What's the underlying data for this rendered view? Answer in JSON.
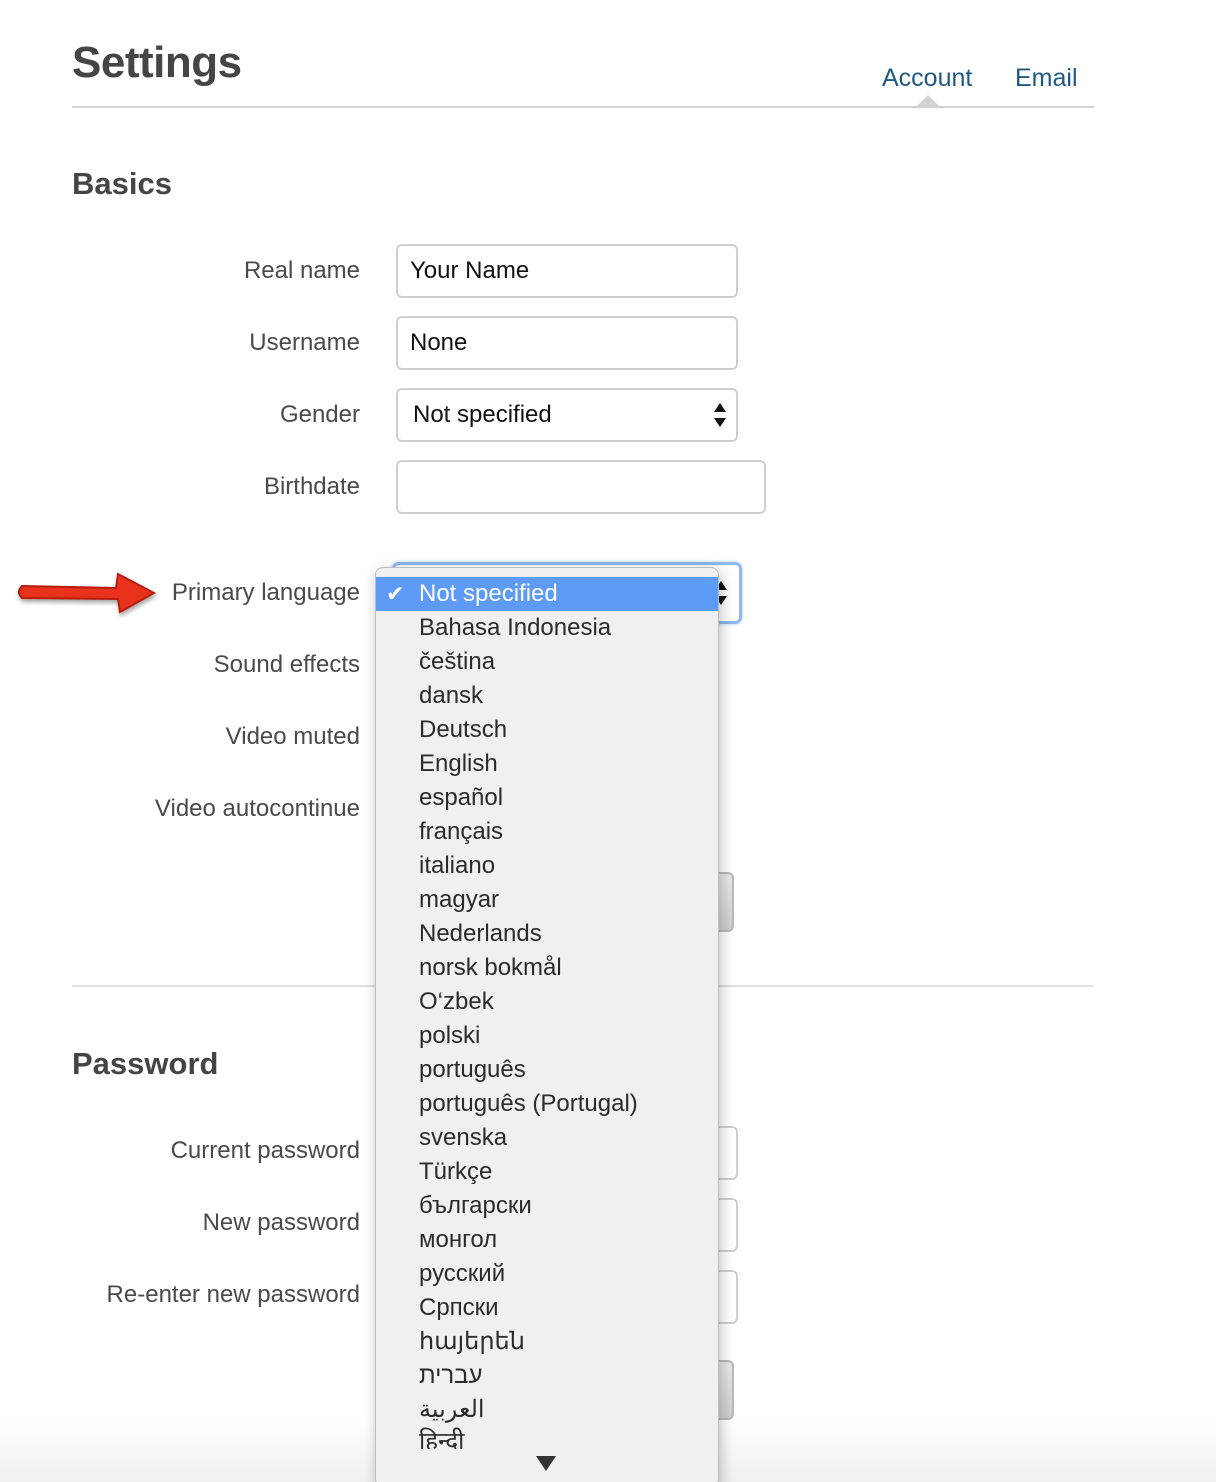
{
  "header": {
    "title": "Settings",
    "tabs": [
      {
        "label": "Account",
        "active": true
      },
      {
        "label": "Email",
        "active": false
      }
    ]
  },
  "basics": {
    "title": "Basics",
    "fields": {
      "real_name": {
        "label": "Real name",
        "value": "Your Name"
      },
      "username": {
        "label": "Username",
        "value": "None"
      },
      "gender": {
        "label": "Gender",
        "value": "Not specified"
      },
      "birthdate": {
        "label": "Birthdate",
        "value": ""
      },
      "primary_language": {
        "label": "Primary language",
        "value": "Not specified"
      },
      "sound_effects": {
        "label": "Sound effects"
      },
      "video_muted": {
        "label": "Video muted"
      },
      "video_autocontinue": {
        "label": "Video autocontinue"
      }
    }
  },
  "password": {
    "title": "Password",
    "fields": {
      "current": {
        "label": "Current password"
      },
      "new": {
        "label": "New password"
      },
      "reenter": {
        "label": "Re-enter new password"
      }
    }
  },
  "language_dropdown": {
    "selected": "Not specified",
    "options": [
      "Not specified",
      "Bahasa Indonesia",
      "čeština",
      "dansk",
      "Deutsch",
      "English",
      "español",
      "français",
      "italiano",
      "magyar",
      "Nederlands",
      "norsk bokmål",
      "O‘zbek",
      "polski",
      "português",
      "português (Portugal)",
      "svenska",
      "Türkçe",
      "български",
      "монгол",
      "русский",
      "Српски",
      "հայերեն",
      "עברית",
      "العربية",
      "हिन्दी"
    ]
  },
  "annotation": {
    "arrow_color": "#e8321e",
    "points_to": "Primary language"
  },
  "colors": {
    "link": "#1f5a85",
    "selection": "#5d9bf6",
    "focus_ring": "#8fb8ec"
  }
}
